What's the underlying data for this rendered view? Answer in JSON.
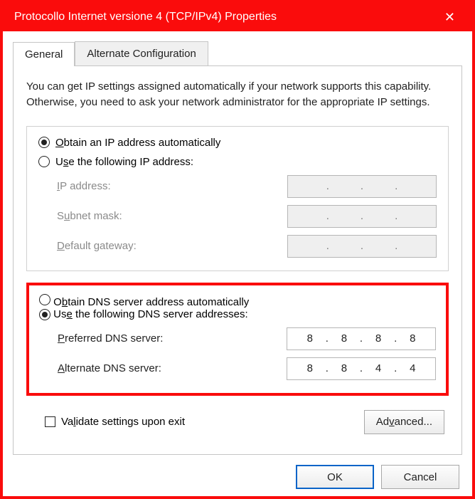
{
  "window": {
    "title": "Protocollo Internet versione 4 (TCP/IPv4) Properties"
  },
  "tabs": {
    "general": "General",
    "alternate": "Alternate Configuration"
  },
  "intro": "You can get IP settings assigned automatically if your network supports this capability. Otherwise, you need to ask your network administrator for the appropriate IP settings.",
  "ip": {
    "auto_label_pre": "",
    "auto_label": "Obtain an IP address automatically",
    "manual_label": "Use the following IP address:",
    "auto_selected": true,
    "fields": {
      "ip_label": "IP address:",
      "subnet_label": "Subnet mask:",
      "gateway_label": "Default gateway:",
      "ip_value": [
        "",
        "",
        "",
        ""
      ],
      "subnet_value": [
        "",
        "",
        "",
        ""
      ],
      "gateway_value": [
        "",
        "",
        "",
        ""
      ]
    }
  },
  "dns": {
    "auto_label": "Obtain DNS server address automatically",
    "manual_label": "Use the following DNS server addresses:",
    "manual_selected": true,
    "fields": {
      "preferred_label": "Preferred DNS server:",
      "alternate_label": "Alternate DNS server:",
      "preferred_value": [
        "8",
        "8",
        "8",
        "8"
      ],
      "alternate_value": [
        "8",
        "8",
        "4",
        "4"
      ]
    }
  },
  "validate_label": "Validate settings upon exit",
  "validate_checked": false,
  "buttons": {
    "advanced": "Advanced...",
    "ok": "OK",
    "cancel": "Cancel"
  }
}
